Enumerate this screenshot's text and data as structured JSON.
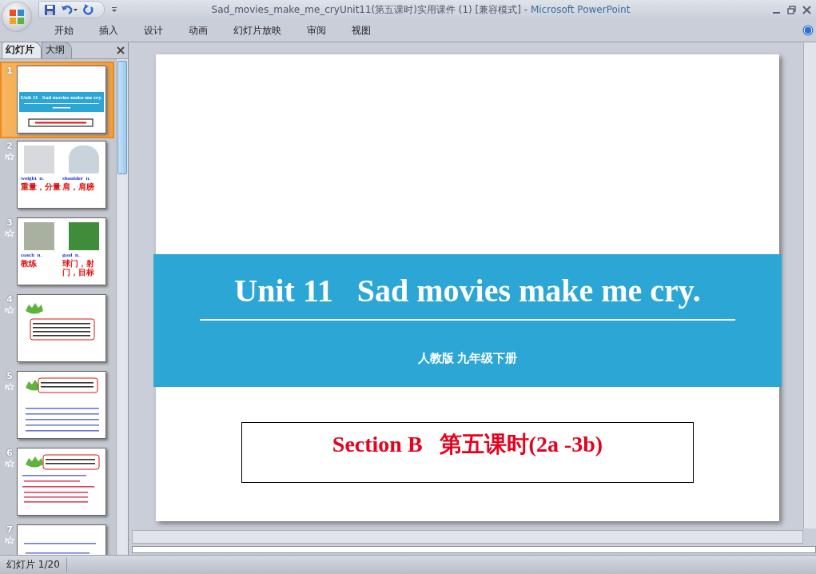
{
  "window": {
    "title": "Sad_movies_make_me_cryUnit11(第五课时)实用课件 (1) [兼容模式]",
    "separator": "-",
    "app_name": "Microsoft PowerPoint"
  },
  "ribbon_tabs": [
    {
      "label": "开始"
    },
    {
      "label": "插入"
    },
    {
      "label": "设计"
    },
    {
      "label": "动画"
    },
    {
      "label": "幻灯片放映"
    },
    {
      "label": "审阅"
    },
    {
      "label": "视图"
    }
  ],
  "panel_tabs": [
    {
      "label": "幻灯片",
      "selected": true
    },
    {
      "label": "大纲",
      "selected": false
    }
  ],
  "thumbnails": [
    {
      "number": "1",
      "selected": true,
      "animated": false,
      "kind": "title",
      "title": "Unit 11   Sad movies make me cry."
    },
    {
      "number": "2",
      "selected": false,
      "animated": true,
      "kind": "vocab",
      "items": [
        {
          "word": "weight",
          "pos": "n.",
          "meaning": "重量，分量"
        },
        {
          "word": "shoulder",
          "pos": "n.",
          "meaning": "肩，肩膀"
        }
      ]
    },
    {
      "number": "3",
      "selected": false,
      "animated": true,
      "kind": "vocab",
      "items": [
        {
          "word": "coach",
          "pos": "n.",
          "meaning": "教练"
        },
        {
          "word": "goal",
          "pos": "n.",
          "meaning": "球门，射门，目标"
        }
      ]
    },
    {
      "number": "4",
      "selected": false,
      "animated": true,
      "kind": "prompt"
    },
    {
      "number": "5",
      "selected": false,
      "animated": true,
      "kind": "list"
    },
    {
      "number": "6",
      "selected": false,
      "animated": true,
      "kind": "questions"
    },
    {
      "number": "7",
      "selected": false,
      "animated": true,
      "kind": "question"
    }
  ],
  "slide": {
    "title": "Unit 11   Sad movies make me cry.",
    "subtitle": "人教版 九年级下册",
    "section": "Section B   第五课时(2a -3b)"
  },
  "status_bar": {
    "slide_count": "幻灯片 1/20"
  }
}
